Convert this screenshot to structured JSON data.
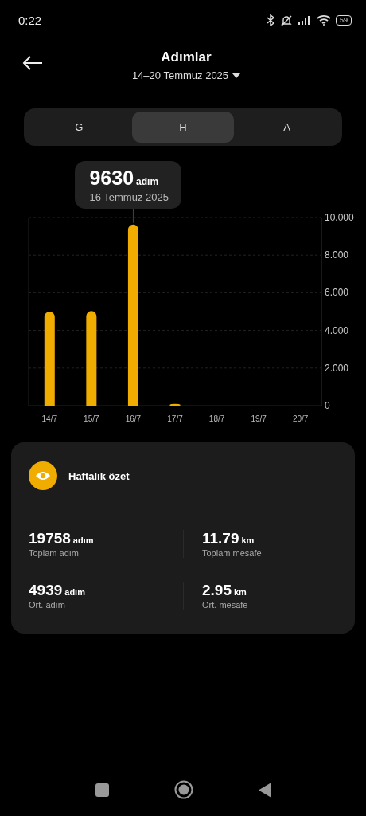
{
  "status_bar": {
    "time": "0:22",
    "battery": "59"
  },
  "header": {
    "title": "Adımlar",
    "date_range": "14–20 Temmuz 2025"
  },
  "tabs": [
    {
      "label": "G",
      "selected": false
    },
    {
      "label": "H",
      "selected": true
    },
    {
      "label": "A",
      "selected": false
    }
  ],
  "chart_data": {
    "type": "bar",
    "categories": [
      "14/7",
      "15/7",
      "16/7",
      "17/7",
      "18/7",
      "19/7",
      "20/7"
    ],
    "series": [
      {
        "color": "#f0ad00",
        "values": [
          5.0,
          5.03,
          9.63,
          0.1,
          0,
          0,
          0
        ]
      }
    ],
    "grid": true,
    "annotations": [
      {
        "x": "16/7"
      }
    ],
    "ylim": [
      0,
      10
    ],
    "yticks": [
      {
        "value": 0,
        "label": "0"
      },
      {
        "value": 2,
        "label": "2.000"
      },
      {
        "value": 4,
        "label": "4.000"
      },
      {
        "value": 6,
        "label": "6.000"
      },
      {
        "value": 8,
        "label": "8.000"
      },
      {
        "value": 10,
        "label": "10.000"
      }
    ]
  },
  "tooltip": {
    "value": "9630",
    "unit": "adım",
    "date": "16 Temmuz 2025"
  },
  "summary": {
    "title": "Haftalık özet",
    "stats": [
      {
        "value": "19758",
        "unit": "adım",
        "label": "Toplam adım"
      },
      {
        "value": "11.79",
        "unit": "km",
        "label": "Toplam mesafe"
      },
      {
        "value": "4939",
        "unit": "adım",
        "label": "Ort. adım"
      },
      {
        "value": "2.95",
        "unit": "km",
        "label": "Ort. mesafe"
      }
    ]
  }
}
